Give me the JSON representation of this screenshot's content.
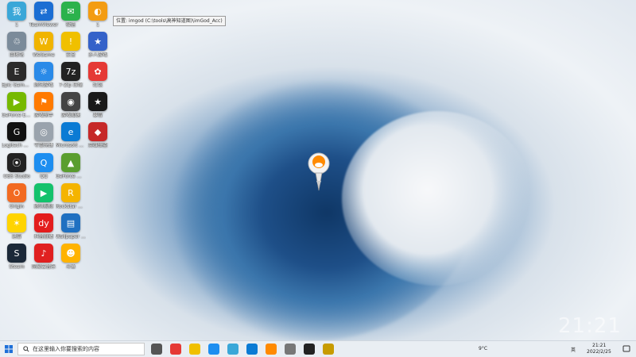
{
  "desktop": {
    "icons": [
      {
        "label": "1",
        "color": "#3aa7d8",
        "glyph": "我"
      },
      {
        "label": "TeamViewer",
        "color": "#1b6ed3",
        "glyph": "⇄"
      },
      {
        "label": "微信",
        "color": "#2bb24c",
        "glyph": "✉"
      },
      {
        "label": "1",
        "color": "#f39c12",
        "glyph": "◐"
      },
      {
        "label": "回收站",
        "color": "#7b8b9a",
        "glyph": "♲"
      },
      {
        "label": "WeGame",
        "color": "#f0b400",
        "glyph": "W"
      },
      {
        "label": "安全",
        "color": "#f0c000",
        "glyph": "!"
      },
      {
        "label": "多人游戏",
        "color": "#3462c9",
        "glyph": "★"
      },
      {
        "label": "Epic Games Launcher",
        "color": "#2b2b2b",
        "glyph": "E"
      },
      {
        "label": "腾讯游戏",
        "color": "#2a8ae8",
        "glyph": "☼"
      },
      {
        "label": "7-Zip 压缩",
        "color": "#222",
        "glyph": "7z"
      },
      {
        "label": "红包",
        "color": "#e53935",
        "glyph": "✿"
      },
      {
        "label": "GeForce Experience",
        "color": "#76b900",
        "glyph": "▶"
      },
      {
        "label": "游戏助手",
        "color": "#ff7a00",
        "glyph": "⚑"
      },
      {
        "label": "游戏加速",
        "color": "#444",
        "glyph": "◉"
      },
      {
        "label": "暴雪",
        "color": "#1a1a1a",
        "glyph": "★"
      },
      {
        "label": "Logitech G HUB",
        "color": "#111",
        "glyph": "G"
      },
      {
        "label": "守望先锋",
        "color": "#9aa3ad",
        "glyph": "◎"
      },
      {
        "label": "Microsoft Edge",
        "color": "#0b7bd4",
        "glyph": "e"
      },
      {
        "label": "英雄联盟",
        "color": "#c62828",
        "glyph": "◆"
      },
      {
        "label": "OBS Studio",
        "color": "#222",
        "glyph": "⦿"
      },
      {
        "label": "QQ",
        "color": "#1d8ef0",
        "glyph": "Q"
      },
      {
        "label": "GeForce 体验",
        "color": "#5a9e2f",
        "glyph": "▲"
      },
      {
        "label": "Origin",
        "color": "#f26a21",
        "glyph": "O"
      },
      {
        "label": "腾讯视频",
        "color": "#13c26c",
        "glyph": "▶"
      },
      {
        "label": "Rockstar Games",
        "color": "#f4b400",
        "glyph": "R"
      },
      {
        "label": "迅雷",
        "color": "#ffd400",
        "glyph": "✶"
      },
      {
        "label": "抖音直播",
        "color": "#e31d1d",
        "glyph": "dy"
      },
      {
        "label": "Wallpaper Engine",
        "color": "#1f70c1",
        "glyph": "▤"
      },
      {
        "label": "Steam",
        "color": "#1b2838",
        "glyph": "S"
      },
      {
        "label": "网易云音乐",
        "color": "#e02020",
        "glyph": "♪"
      },
      {
        "label": "斗鱼",
        "color": "#ffb300",
        "glyph": "☻"
      }
    ],
    "tooltip": "位置: imgod (C:\\tools\\高神知道图)\\imGod_Acc)",
    "big_time": "21:21"
  },
  "taskbar": {
    "search_placeholder": "在这里输入你要搜索的内容",
    "apps": [
      "task-view",
      "chrome",
      "file-explorer",
      "mail",
      "photos",
      "edge",
      "game",
      "settings",
      "obs",
      "app"
    ],
    "tray": {
      "weather": "9°C",
      "lang": "英",
      "time": "21:21",
      "date": "2022/2/25"
    }
  }
}
